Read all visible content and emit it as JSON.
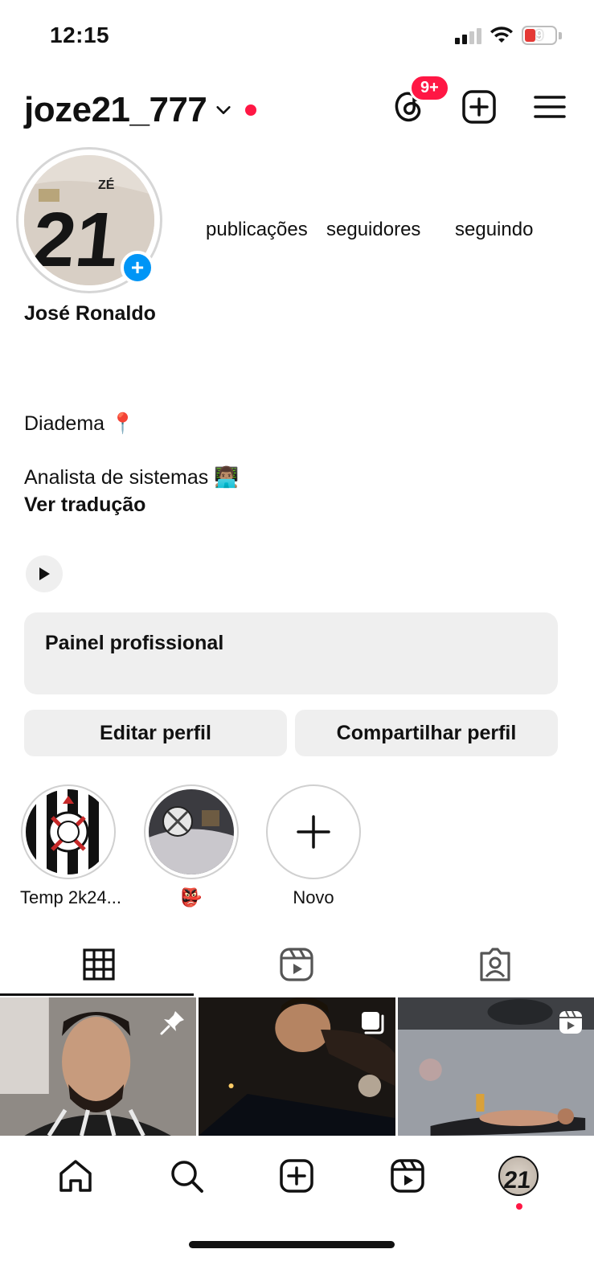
{
  "status_bar": {
    "time": "12:15",
    "battery_level": "9",
    "signal_bars": 2,
    "icons": [
      "signal-icon",
      "wifi-icon",
      "battery-icon"
    ]
  },
  "header": {
    "username": "joze21_777",
    "threads_badge": "9+",
    "icons": [
      "chevron-down-icon",
      "threads-icon",
      "create-icon",
      "menu-icon"
    ],
    "accent_color": "#ff1744"
  },
  "profile": {
    "display_name": "José Ronaldo",
    "stats": {
      "posts_label": "publicações",
      "followers_label": "seguidores",
      "following_label": "seguindo"
    },
    "bio": {
      "line1": "Diadema 📍",
      "line2": "Analista de sistemas 👨🏽‍💻",
      "translate_link": "Ver tradução"
    }
  },
  "professional_panel": {
    "title": "Painel profissional"
  },
  "actions": {
    "edit_profile": "Editar perfil",
    "share_profile": "Compartilhar perfil"
  },
  "highlights": [
    {
      "label": "Temp 2k24..."
    },
    {
      "label": "👺"
    },
    {
      "label": "Novo"
    }
  ],
  "tabs": [
    "grid-icon",
    "reels-icon",
    "tagged-icon"
  ],
  "posts": [
    {
      "icon": "pin-icon"
    },
    {
      "icon": "carousel-icon"
    },
    {
      "icon": "reel-icon"
    }
  ],
  "bottom_nav": [
    "home-icon",
    "search-icon",
    "create-icon",
    "reels-icon",
    "profile-avatar"
  ],
  "colors": {
    "link_blue": "#0095f6",
    "button_gray": "#efefef"
  }
}
